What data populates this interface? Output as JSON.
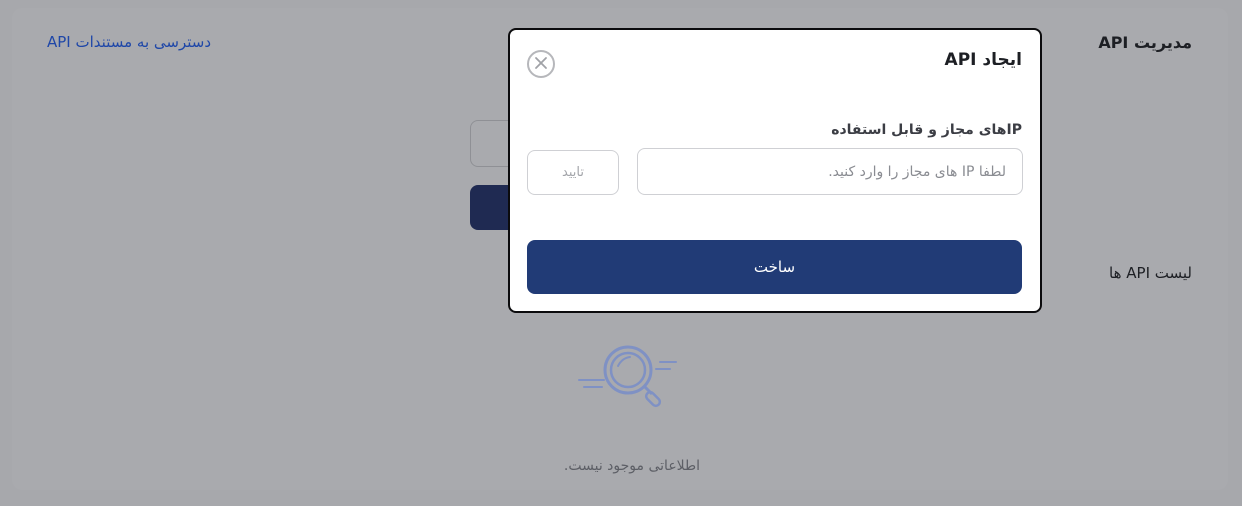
{
  "page": {
    "title": "مدیریت API",
    "docs_link": "دسترسی به مستندات API",
    "list_title": "لیست API ها",
    "empty_text": "اطلاعاتی موجود نیست.",
    "empty_icon": "search-magnifier-icon"
  },
  "modal": {
    "title": "ایجاد API",
    "close_icon": "close-icon",
    "field_label": "IPهای مجاز و قابل استفاده",
    "ip_input": {
      "value": "",
      "placeholder": "لطفا IP های مجاز را وارد کنید."
    },
    "confirm_label": "تایید",
    "create_label": "ساخت"
  },
  "colors": {
    "overlay_bg": "#a7a8ac",
    "primary": "#213b76",
    "link": "#1f47a8",
    "modal_bg": "#ffffff"
  }
}
